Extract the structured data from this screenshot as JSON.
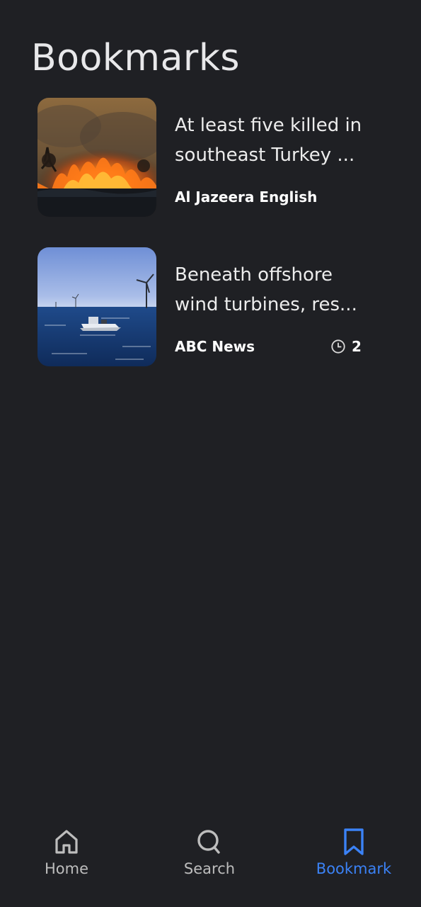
{
  "page": {
    "title": "Bookmarks"
  },
  "bookmarks": [
    {
      "title_line1": "At least five killed in",
      "title_line2": "southeast Turkey ...",
      "source": "Al Jazeera English",
      "thumbnail": "wildfire-image"
    },
    {
      "title_line1": "Beneath offshore",
      "title_line2": "wind turbines, res...",
      "source": "ABC News",
      "time_value": "2",
      "thumbnail": "offshore-wind-boat-image"
    }
  ],
  "nav": {
    "home_label": "Home",
    "search_label": "Search",
    "bookmark_label": "Bookmark",
    "active": "bookmark"
  },
  "colors": {
    "background": "#1f2024",
    "accent": "#3b82f6",
    "text_primary": "#ffffff",
    "nav_inactive": "#bdbdbd"
  }
}
